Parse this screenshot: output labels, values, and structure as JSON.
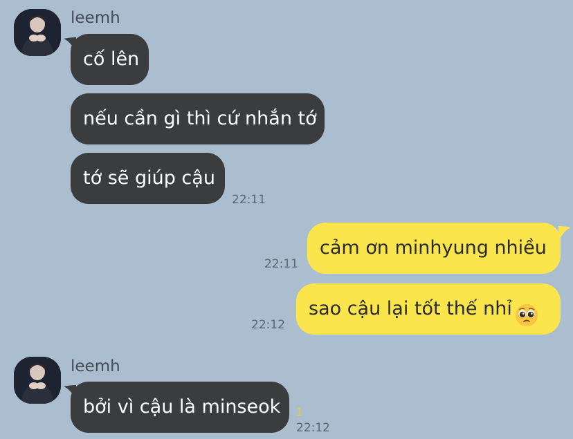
{
  "messages": [
    {
      "sender": "leemh",
      "lines": [
        "cố lên",
        "nếu cần gì thì cứ nhắn tớ",
        "tớ sẽ giúp cậu"
      ],
      "time": "22:11"
    },
    {
      "outgoing": true,
      "lines": [
        "cảm ơn minhyung nhiều",
        "sao cậu lại tốt thế nhỉ"
      ],
      "times": [
        "22:11",
        "22:12"
      ],
      "emoji": "pleading-face"
    },
    {
      "sender": "leemh",
      "lines": [
        "bởi vì cậu là minseok"
      ],
      "time": "22:12",
      "unread": "1"
    }
  ],
  "colors": {
    "background": "#abbecf",
    "incoming_bubble": "#3b3c3e",
    "outgoing_bubble": "#fbe54d"
  }
}
